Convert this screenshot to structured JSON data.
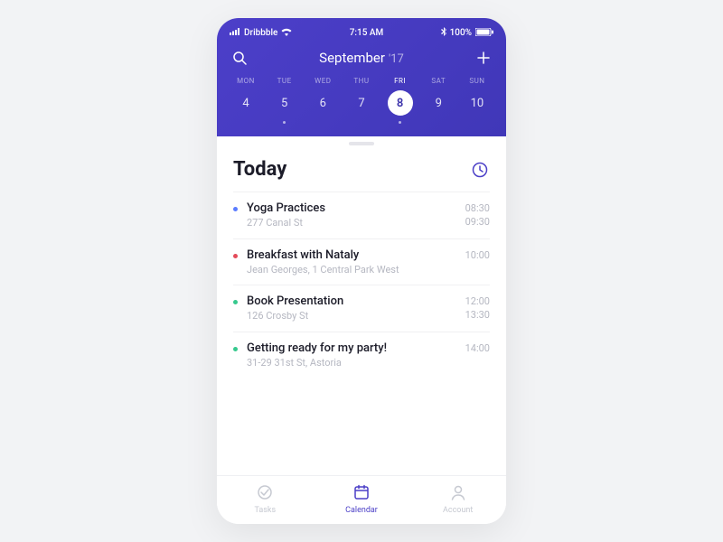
{
  "status": {
    "carrier": "Dribbble",
    "time": "7:15 AM",
    "battery": "100%"
  },
  "header": {
    "month": "September",
    "year": "'17"
  },
  "week": [
    {
      "label": "MON",
      "num": "4",
      "dot": false,
      "selected": false
    },
    {
      "label": "TUE",
      "num": "5",
      "dot": true,
      "selected": false
    },
    {
      "label": "WED",
      "num": "6",
      "dot": false,
      "selected": false
    },
    {
      "label": "THU",
      "num": "7",
      "dot": false,
      "selected": false
    },
    {
      "label": "FRI",
      "num": "8",
      "dot": true,
      "selected": true
    },
    {
      "label": "SAT",
      "num": "9",
      "dot": false,
      "selected": false
    },
    {
      "label": "SUN",
      "num": "10",
      "dot": false,
      "selected": false
    }
  ],
  "section_title": "Today",
  "events": [
    {
      "color": "#5b7cff",
      "title": "Yoga Practices",
      "sub": "277 Canal St",
      "start": "08:30",
      "end": "09:30"
    },
    {
      "color": "#e44b5a",
      "title": "Breakfast with Nataly",
      "sub": "Jean Georges, 1 Central Park West",
      "start": "10:00",
      "end": ""
    },
    {
      "color": "#36c98e",
      "title": "Book Presentation",
      "sub": "126 Crosby St",
      "start": "12:00",
      "end": "13:30"
    },
    {
      "color": "#36c98e",
      "title": "Getting ready for my party!",
      "sub": "31-29 31st St, Astoria",
      "start": "14:00",
      "end": ""
    }
  ],
  "tabs": [
    {
      "label": "Tasks",
      "active": false
    },
    {
      "label": "Calendar",
      "active": true
    },
    {
      "label": "Account",
      "active": false
    }
  ]
}
